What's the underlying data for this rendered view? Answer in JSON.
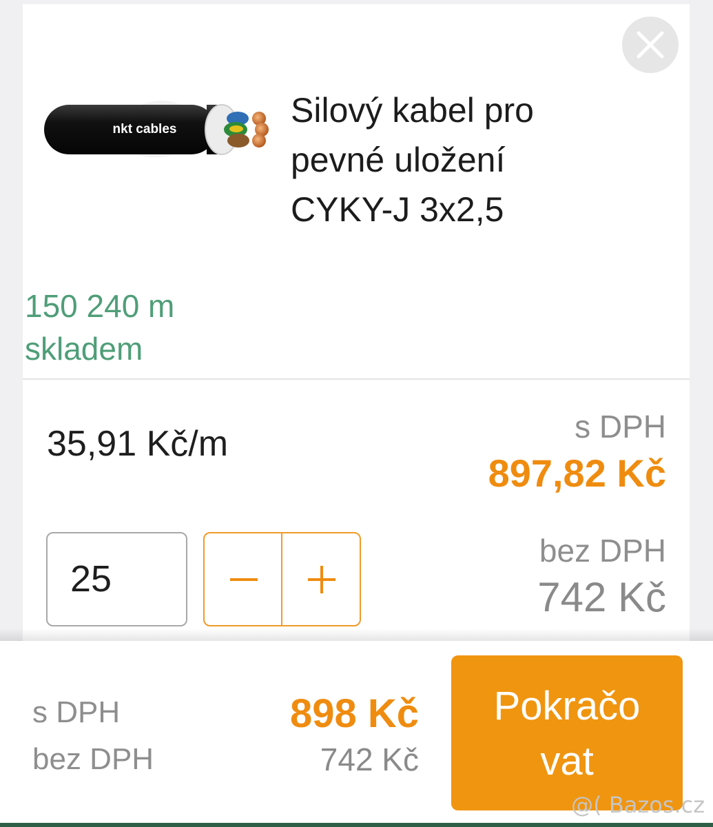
{
  "product": {
    "title_lines": [
      "Silový kabel pro",
      "pevné uložení",
      "CYKY-J 3x2,5"
    ],
    "image_brand_text": "nkt cables",
    "stock_lines": [
      "150 240 m",
      "skladem"
    ]
  },
  "pricing": {
    "unit_price": "35,91 Kč/m",
    "with_vat_label": "s DPH",
    "with_vat_value": "897,82 Kč",
    "without_vat_label": "bez DPH",
    "without_vat_value": "742 Kč"
  },
  "quantity": {
    "value": "25",
    "minus_label": "minus",
    "plus_label": "plus"
  },
  "footer": {
    "with_vat_label": "s DPH",
    "without_vat_label": "bez DPH",
    "total_with_vat": "898 Kč",
    "total_without_vat": "742 Kč",
    "continue_lines": [
      "Pokračo",
      "vat"
    ]
  },
  "watermark": "@( Bazos.cz",
  "colors": {
    "accent": "#ef8c10",
    "stock_green": "#4f9e78",
    "button": "#f09510"
  },
  "icons": {
    "close": "close-icon",
    "minus": "minus-icon",
    "plus": "plus-icon"
  }
}
